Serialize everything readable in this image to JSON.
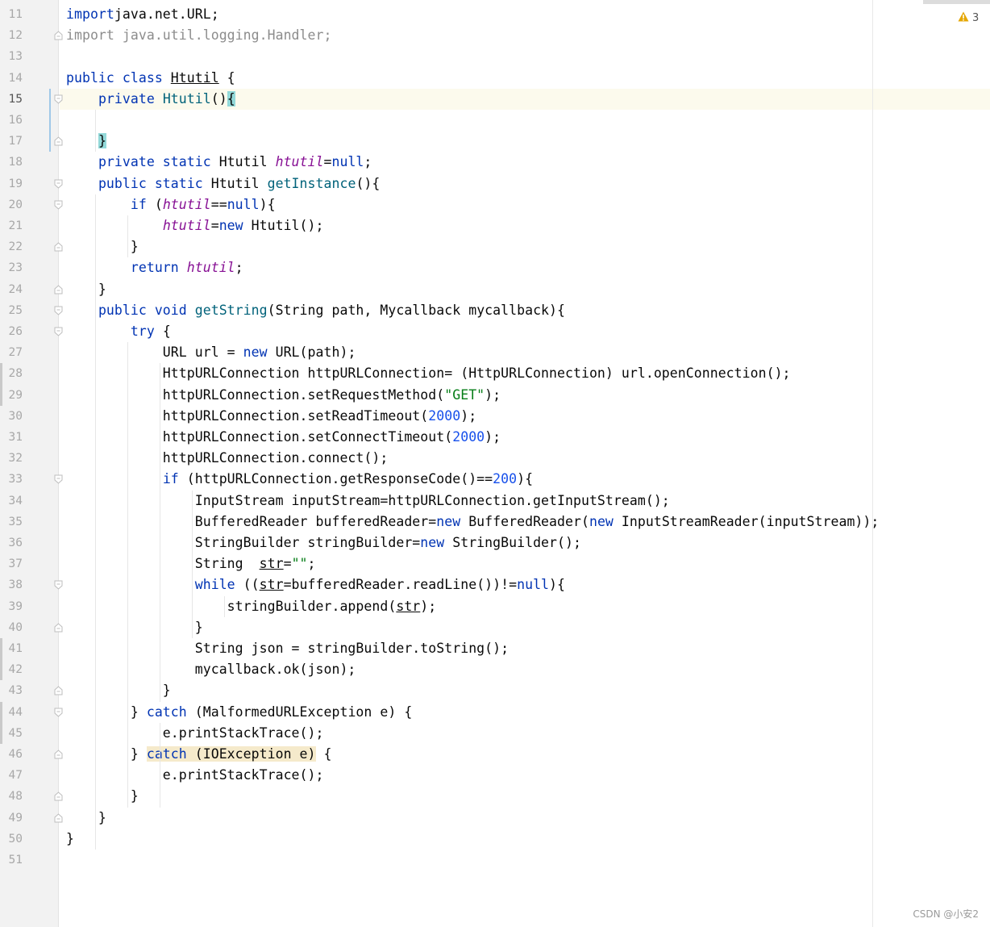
{
  "editor": {
    "current_line": 15,
    "warnings": {
      "count": "3",
      "icon": "warning-icon",
      "color": "#e5a600"
    },
    "watermark": "CSDN @小安2",
    "lines": [
      {
        "n": "11",
        "tokens": [
          [
            "kw",
            "import"
          ],
          [
            "",
            "java.net.URL;"
          ]
        ]
      },
      {
        "n": "12",
        "tokens": [
          [
            "imp-grey",
            "import java.util.logging.Handler;"
          ]
        ]
      },
      {
        "n": "13",
        "tokens": []
      },
      {
        "n": "14",
        "tokens": [
          [
            "kw",
            "public class "
          ],
          [
            "ul",
            "Htutil"
          ],
          [
            "",
            " {"
          ]
        ]
      },
      {
        "n": "15",
        "tokens": [
          [
            "",
            "    "
          ],
          [
            "kw",
            "private "
          ],
          [
            "fn",
            "Htutil"
          ],
          [
            "",
            "()"
          ],
          [
            "hl-brace",
            "{"
          ]
        ]
      },
      {
        "n": "16",
        "tokens": []
      },
      {
        "n": "17",
        "tokens": [
          [
            "",
            "    "
          ],
          [
            "hl-brace",
            "}"
          ]
        ]
      },
      {
        "n": "18",
        "tokens": [
          [
            "",
            "    "
          ],
          [
            "kw",
            "private static "
          ],
          [
            "",
            "Htutil "
          ],
          [
            "st",
            "htutil"
          ],
          [
            "",
            "="
          ],
          [
            "kw",
            "null"
          ],
          [
            "",
            ";"
          ]
        ]
      },
      {
        "n": "19",
        "tokens": [
          [
            "",
            "    "
          ],
          [
            "kw",
            "public static "
          ],
          [
            "",
            "Htutil "
          ],
          [
            "fn",
            "getInstance"
          ],
          [
            "",
            "(){"
          ]
        ]
      },
      {
        "n": "20",
        "tokens": [
          [
            "",
            "        "
          ],
          [
            "kw",
            "if "
          ],
          [
            "",
            "("
          ],
          [
            "st",
            "htutil"
          ],
          [
            "",
            "=="
          ],
          [
            "kw",
            "null"
          ],
          [
            "",
            "){"
          ]
        ]
      },
      {
        "n": "21",
        "tokens": [
          [
            "",
            "            "
          ],
          [
            "st",
            "htutil"
          ],
          [
            "",
            "="
          ],
          [
            "kw",
            "new "
          ],
          [
            "",
            "Htutil();"
          ]
        ]
      },
      {
        "n": "22",
        "tokens": [
          [
            "",
            "        }"
          ]
        ]
      },
      {
        "n": "23",
        "tokens": [
          [
            "",
            "        "
          ],
          [
            "kw",
            "return "
          ],
          [
            "st",
            "htutil"
          ],
          [
            "",
            ";"
          ]
        ]
      },
      {
        "n": "24",
        "tokens": [
          [
            "",
            "    }"
          ]
        ]
      },
      {
        "n": "25",
        "tokens": [
          [
            "",
            "    "
          ],
          [
            "kw",
            "public void "
          ],
          [
            "fn",
            "getString"
          ],
          [
            "",
            "(String path, Mycallback mycallback){"
          ]
        ]
      },
      {
        "n": "26",
        "tokens": [
          [
            "",
            "        "
          ],
          [
            "kw",
            "try "
          ],
          [
            "",
            "{"
          ]
        ]
      },
      {
        "n": "27",
        "tokens": [
          [
            "",
            "            URL url = "
          ],
          [
            "kw",
            "new "
          ],
          [
            "",
            "URL(path);"
          ]
        ]
      },
      {
        "n": "28",
        "tokens": [
          [
            "",
            "            HttpURLConnection httpURLConnection= (HttpURLConnection) url.openConnection();"
          ]
        ]
      },
      {
        "n": "29",
        "tokens": [
          [
            "",
            "            httpURLConnection.setRequestMethod("
          ],
          [
            "str",
            "\"GET\""
          ],
          [
            "",
            ");"
          ]
        ]
      },
      {
        "n": "30",
        "tokens": [
          [
            "",
            "            httpURLConnection.setReadTimeout("
          ],
          [
            "num",
            "2000"
          ],
          [
            "",
            ");"
          ]
        ]
      },
      {
        "n": "31",
        "tokens": [
          [
            "",
            "            httpURLConnection.setConnectTimeout("
          ],
          [
            "num",
            "2000"
          ],
          [
            "",
            ");"
          ]
        ]
      },
      {
        "n": "32",
        "tokens": [
          [
            "",
            "            httpURLConnection.connect();"
          ]
        ]
      },
      {
        "n": "33",
        "tokens": [
          [
            "",
            "            "
          ],
          [
            "kw",
            "if "
          ],
          [
            "",
            "(httpURLConnection.getResponseCode()=="
          ],
          [
            "num",
            "200"
          ],
          [
            "",
            "){"
          ]
        ]
      },
      {
        "n": "34",
        "tokens": [
          [
            "",
            "                InputStream inputStream=httpURLConnection.getInputStream();"
          ]
        ]
      },
      {
        "n": "35",
        "tokens": [
          [
            "",
            "                BufferedReader bufferedReader="
          ],
          [
            "kw",
            "new "
          ],
          [
            "",
            "BufferedReader("
          ],
          [
            "kw",
            "new "
          ],
          [
            "",
            "InputStreamReader(inputStream));"
          ]
        ]
      },
      {
        "n": "36",
        "tokens": [
          [
            "",
            "                StringBuilder stringBuilder="
          ],
          [
            "kw",
            "new "
          ],
          [
            "",
            "StringBuilder();"
          ]
        ]
      },
      {
        "n": "37",
        "tokens": [
          [
            "",
            "                String  "
          ],
          [
            "ul",
            "str"
          ],
          [
            "",
            "="
          ],
          [
            "str",
            "\"\""
          ],
          [
            "",
            ";"
          ]
        ]
      },
      {
        "n": "38",
        "tokens": [
          [
            "",
            "                "
          ],
          [
            "kw",
            "while "
          ],
          [
            "",
            "(("
          ],
          [
            "ul",
            "str"
          ],
          [
            "",
            "=bufferedReader.readLine())!="
          ],
          [
            "kw",
            "null"
          ],
          [
            "",
            "){"
          ]
        ]
      },
      {
        "n": "39",
        "tokens": [
          [
            "",
            "                    stringBuilder.append("
          ],
          [
            "ul",
            "str"
          ],
          [
            "",
            ");"
          ]
        ]
      },
      {
        "n": "40",
        "tokens": [
          [
            "",
            "                }"
          ]
        ]
      },
      {
        "n": "41",
        "tokens": [
          [
            "",
            "                String json = stringBuilder.toString();"
          ]
        ]
      },
      {
        "n": "42",
        "tokens": [
          [
            "",
            "                mycallback.ok(json);"
          ]
        ]
      },
      {
        "n": "43",
        "tokens": [
          [
            "",
            "            }"
          ]
        ]
      },
      {
        "n": "44",
        "tokens": [
          [
            "",
            "        } "
          ],
          [
            "kw",
            "catch "
          ],
          [
            "",
            "(MalformedURLException e) {"
          ]
        ]
      },
      {
        "n": "45",
        "tokens": [
          [
            "",
            "            e.printStackTrace();"
          ]
        ]
      },
      {
        "n": "46",
        "tokens": [
          [
            "",
            "        } "
          ],
          [
            "hl-catch-kw",
            "catch"
          ],
          [
            "hl-catch",
            " (IOException e)"
          ],
          [
            "",
            " {"
          ]
        ]
      },
      {
        "n": "47",
        "tokens": [
          [
            "",
            "            e.printStackTrace();"
          ]
        ]
      },
      {
        "n": "48",
        "tokens": [
          [
            "",
            "        }"
          ]
        ]
      },
      {
        "n": "49",
        "tokens": [
          [
            "",
            "    }"
          ]
        ]
      },
      {
        "n": "50",
        "tokens": [
          [
            "",
            "}"
          ]
        ]
      },
      {
        "n": "51",
        "tokens": []
      }
    ]
  }
}
